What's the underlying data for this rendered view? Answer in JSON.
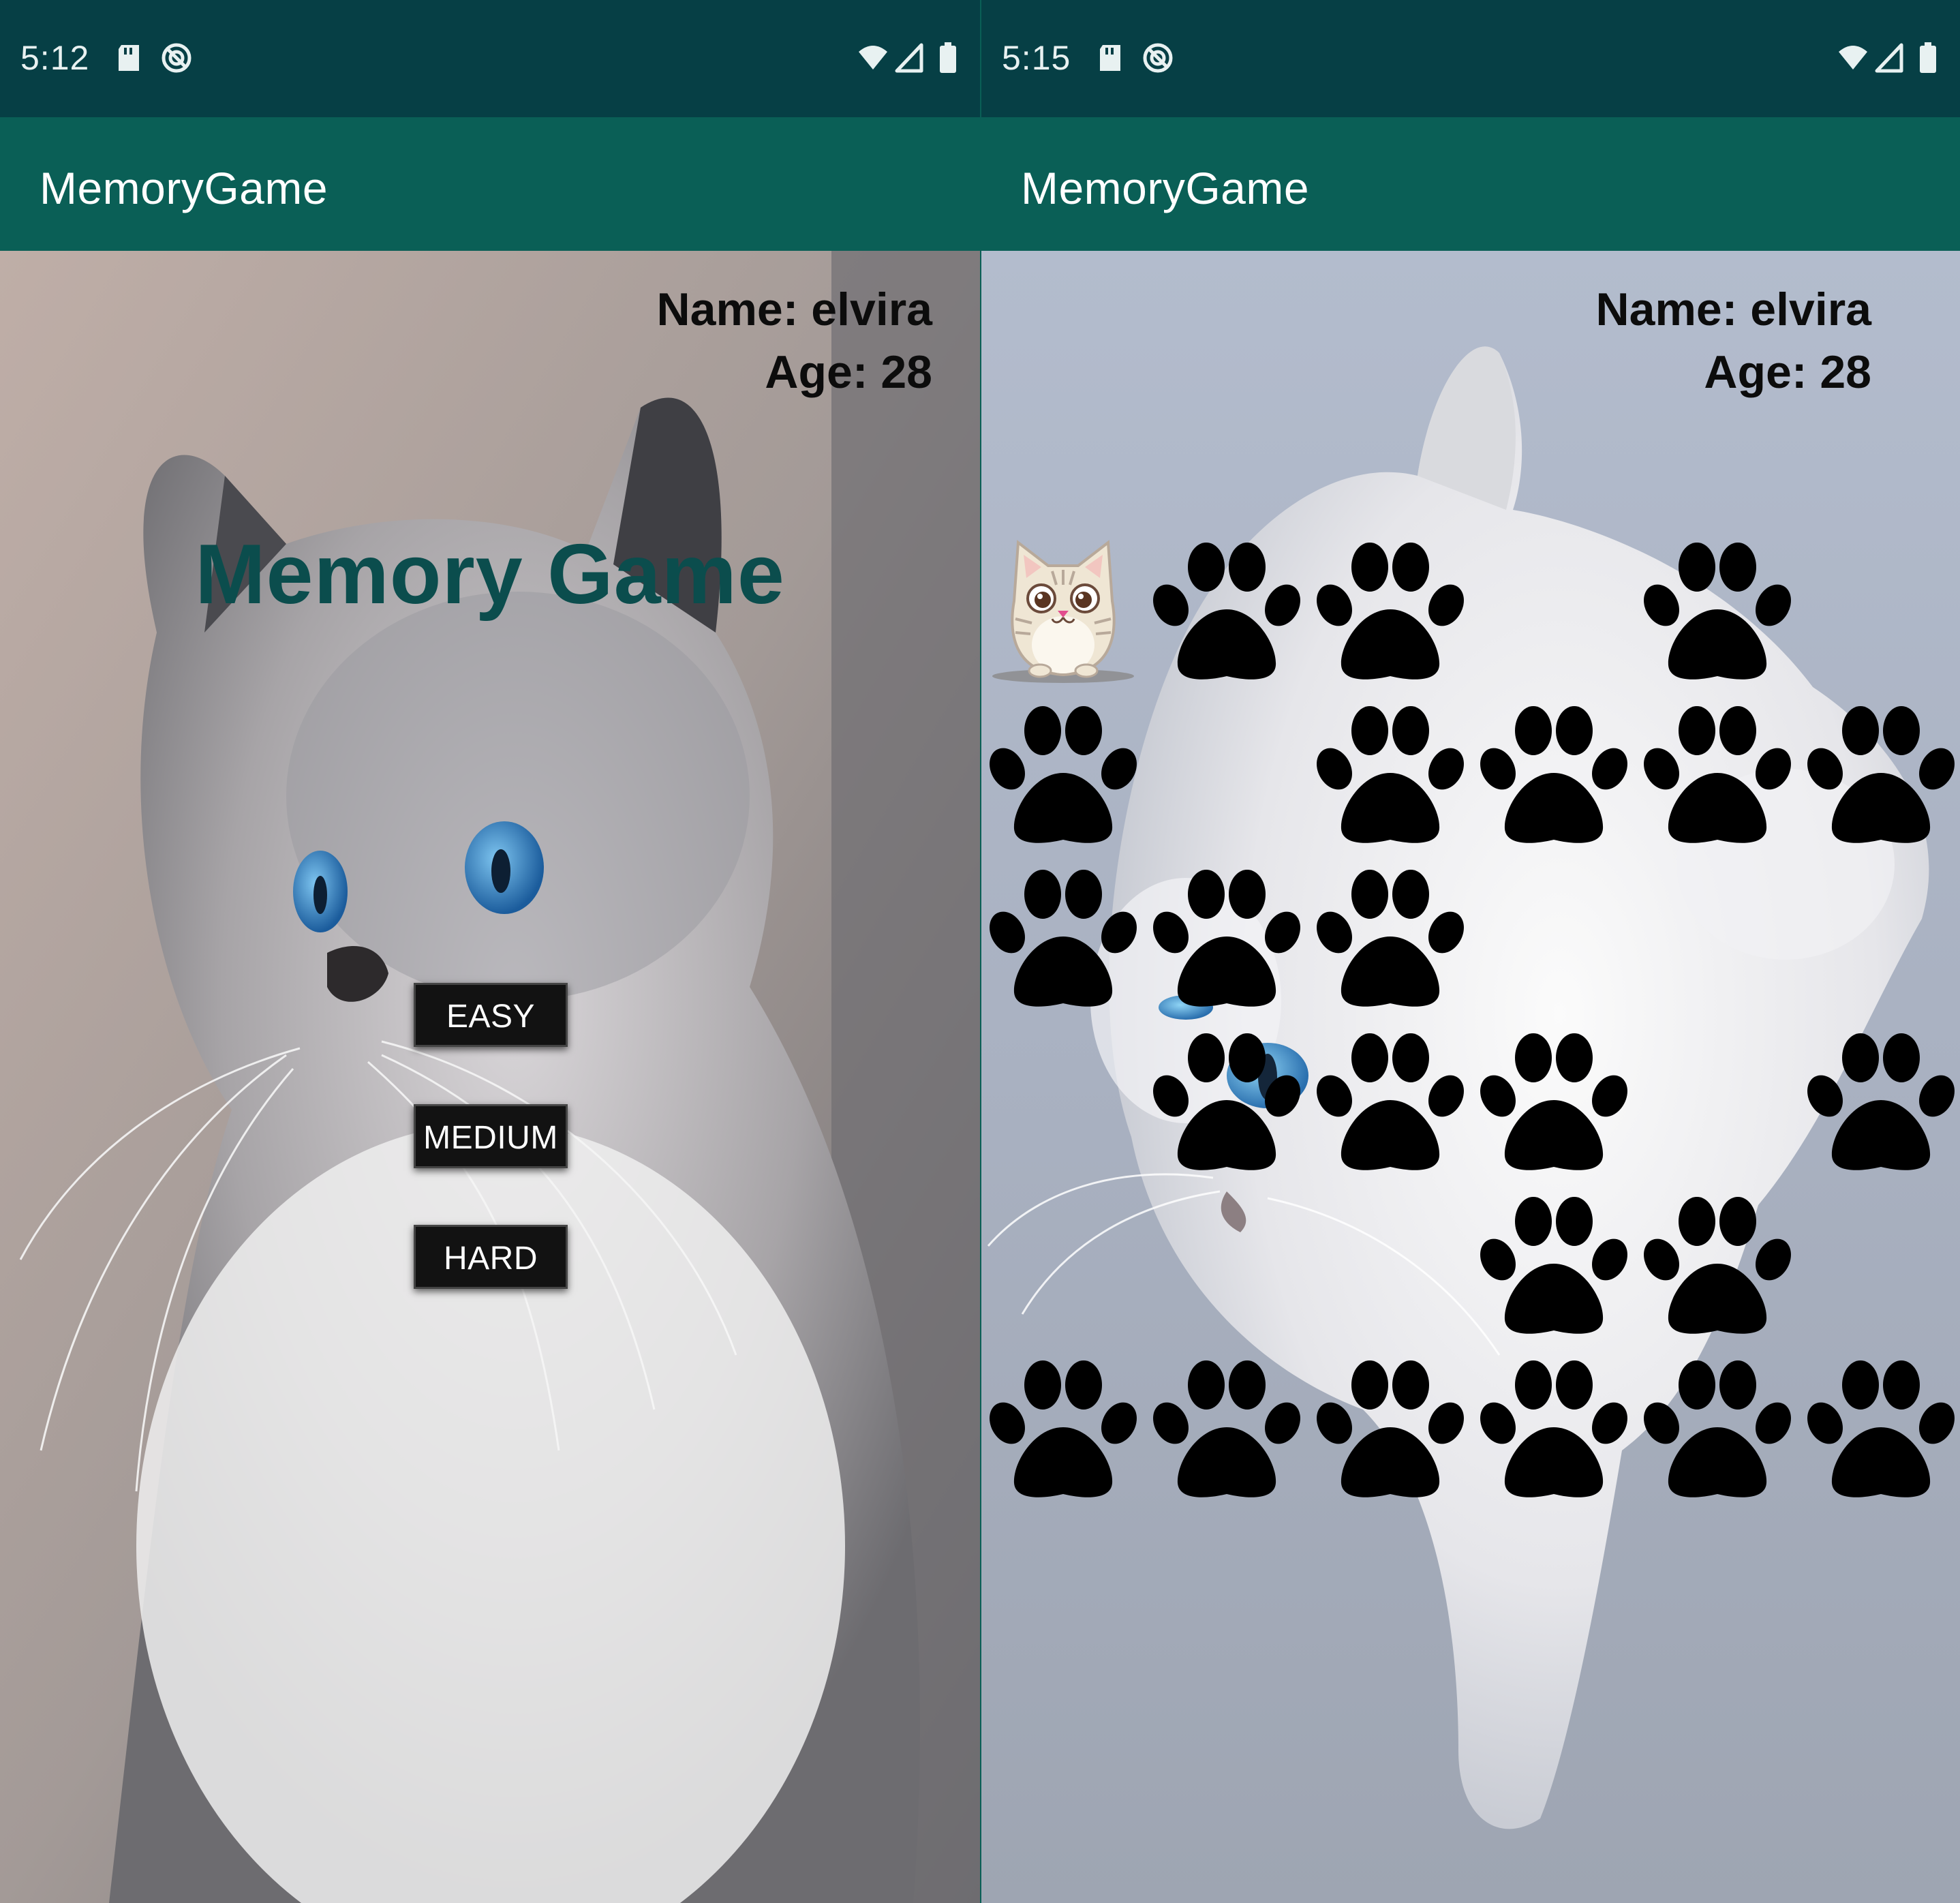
{
  "screens": [
    {
      "status_time": "5:12",
      "app_title": "MemoryGame",
      "user": {
        "name_line": "Name: elvira",
        "age_line": "Age: 28"
      },
      "title": "Memory Game",
      "buttons": {
        "easy": "EASY",
        "medium": "MEDIUM",
        "hard": "HARD"
      }
    },
    {
      "status_time": "5:15",
      "app_title": "MemoryGame",
      "user": {
        "name_line": "Name: elvira",
        "age_line": "Age: 28"
      },
      "board": {
        "columns": 6,
        "rows": 6,
        "cells": [
          "cat",
          "paw",
          "paw",
          "empty",
          "paw",
          "empty",
          "paw",
          "empty",
          "paw",
          "paw",
          "paw",
          "paw",
          "paw",
          "paw",
          "paw",
          "empty",
          "empty",
          "empty",
          "empty",
          "paw",
          "paw",
          "paw",
          "empty",
          "paw",
          "empty",
          "empty",
          "empty",
          "paw",
          "paw",
          "empty",
          "paw",
          "paw",
          "paw",
          "paw",
          "paw",
          "paw"
        ]
      }
    }
  ],
  "colors": {
    "status_bar": "#063f45",
    "app_bar": "#0a5f56",
    "title_text": "#0b4d4d",
    "button_bg": "#121212"
  },
  "icons": {
    "status": [
      "sd-card-icon",
      "do-not-disturb-icon",
      "wifi-icon",
      "cell-signal-icon",
      "battery-icon"
    ],
    "card_back": "paw-icon",
    "card_face": "cat-icon"
  }
}
